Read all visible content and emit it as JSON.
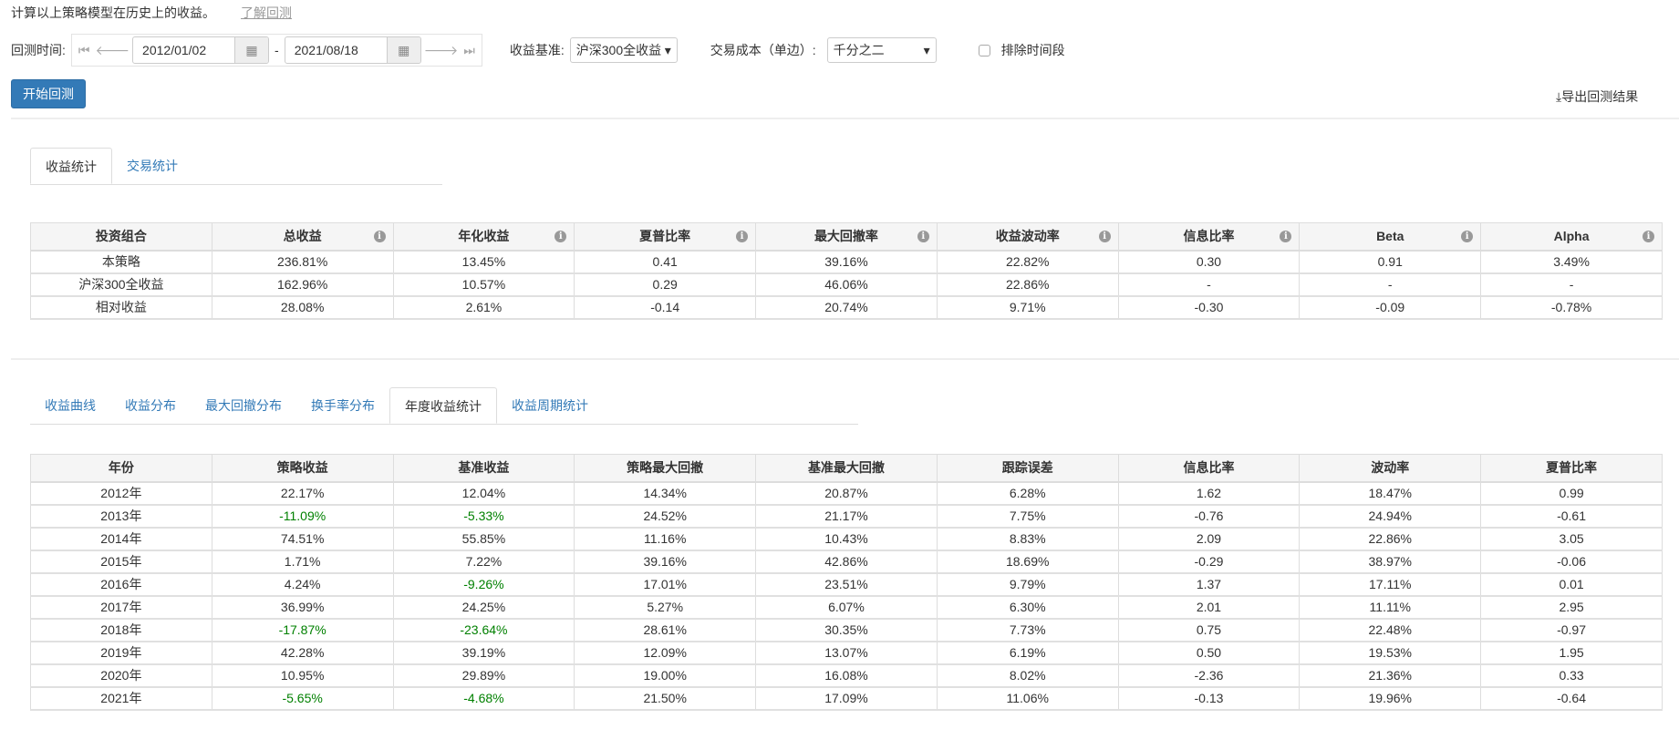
{
  "intro": {
    "text": "计算以上策略模型在历史上的收益。",
    "link": "了解回测"
  },
  "controls": {
    "time_label": "回测时间:",
    "start_date": "2012/01/02",
    "end_date": "2021/08/18",
    "dash": "-",
    "benchmark_label": "收益基准:",
    "benchmark_value": "沪深300全收益",
    "cost_label": "交易成本（单边）:",
    "cost_value": "千分之二",
    "exclude_label": "排除时间段",
    "start_button": "开始回测",
    "export_button": "导出回测结果"
  },
  "tabs1": [
    "收益统计",
    "交易统计"
  ],
  "summary": {
    "headers": [
      "投资组合",
      "总收益",
      "年化收益",
      "夏普比率",
      "最大回撤率",
      "收益波动率",
      "信息比率",
      "Beta",
      "Alpha"
    ],
    "rows": [
      [
        "本策略",
        "236.81%",
        "13.45%",
        "0.41",
        "39.16%",
        "22.82%",
        "0.30",
        "0.91",
        "3.49%"
      ],
      [
        "沪深300全收益",
        "162.96%",
        "10.57%",
        "0.29",
        "46.06%",
        "22.86%",
        "-",
        "-",
        "-"
      ],
      [
        "相对收益",
        "28.08%",
        "2.61%",
        "-0.14",
        "20.74%",
        "9.71%",
        "-0.30",
        "-0.09",
        "-0.78%"
      ]
    ]
  },
  "tabs2": [
    "收益曲线",
    "收益分布",
    "最大回撤分布",
    "换手率分布",
    "年度收益统计",
    "收益周期统计"
  ],
  "yearly": {
    "headers": [
      "年份",
      "策略收益",
      "基准收益",
      "策略最大回撤",
      "基准最大回撤",
      "跟踪误差",
      "信息比率",
      "波动率",
      "夏普比率"
    ],
    "rows": [
      [
        "2012年",
        "22.17%",
        "12.04%",
        "14.34%",
        "20.87%",
        "6.28%",
        "1.62",
        "18.47%",
        "0.99"
      ],
      [
        "2013年",
        "-11.09%",
        "-5.33%",
        "24.52%",
        "21.17%",
        "7.75%",
        "-0.76",
        "24.94%",
        "-0.61"
      ],
      [
        "2014年",
        "74.51%",
        "55.85%",
        "11.16%",
        "10.43%",
        "8.83%",
        "2.09",
        "22.86%",
        "3.05"
      ],
      [
        "2015年",
        "1.71%",
        "7.22%",
        "39.16%",
        "42.86%",
        "18.69%",
        "-0.29",
        "38.97%",
        "-0.06"
      ],
      [
        "2016年",
        "4.24%",
        "-9.26%",
        "17.01%",
        "23.51%",
        "9.79%",
        "1.37",
        "17.11%",
        "0.01"
      ],
      [
        "2017年",
        "36.99%",
        "24.25%",
        "5.27%",
        "6.07%",
        "6.30%",
        "2.01",
        "11.11%",
        "2.95"
      ],
      [
        "2018年",
        "-17.87%",
        "-23.64%",
        "28.61%",
        "30.35%",
        "7.73%",
        "0.75",
        "22.48%",
        "-0.97"
      ],
      [
        "2019年",
        "42.28%",
        "39.19%",
        "12.09%",
        "13.07%",
        "6.19%",
        "0.50",
        "19.53%",
        "1.95"
      ],
      [
        "2020年",
        "10.95%",
        "29.89%",
        "19.00%",
        "16.08%",
        "8.02%",
        "-2.36",
        "21.36%",
        "0.33"
      ],
      [
        "2021年",
        "-5.65%",
        "-4.68%",
        "21.50%",
        "17.09%",
        "11.06%",
        "-0.13",
        "19.96%",
        "-0.64"
      ]
    ]
  },
  "colors": {
    "primary": "#337ab7",
    "negative": "#008000"
  }
}
